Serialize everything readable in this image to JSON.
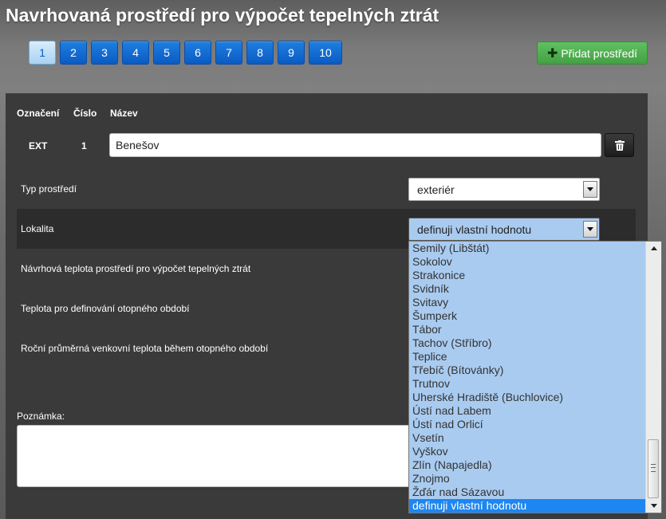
{
  "header": {
    "title": "Navrhovaná prostředí pro výpočet tepelných ztrát"
  },
  "pagination": {
    "pages": [
      "1",
      "2",
      "3",
      "4",
      "5",
      "6",
      "7",
      "8",
      "9",
      "10"
    ],
    "active_index": 0
  },
  "toolbar": {
    "add_env_label": "Přidat prostředí",
    "add_env_icon": "plus-icon"
  },
  "table": {
    "headers": {
      "designation": "Označení",
      "number": "Číslo",
      "name": "Název"
    },
    "row": {
      "designation": "EXT",
      "number": "1",
      "name": "Benešov"
    },
    "delete_icon": "trash-icon"
  },
  "form": {
    "env_type": {
      "label": "Typ prostředí",
      "value": "exteriér"
    },
    "locality": {
      "label": "Lokalita",
      "value": "definuji vlastní hodnotu"
    },
    "design_temp": {
      "label": "Návrhová teplota prostředí pro výpočet tepelných ztrát"
    },
    "heating_temp": {
      "label": "Teplota pro definování otopného období"
    },
    "avg_temp": {
      "label": "Roční průměrná venkovní teplota během otopného období"
    },
    "note": {
      "label": "Poznámka:",
      "value": ""
    }
  },
  "dropdown": {
    "options": [
      "Semily (Libštát)",
      "Sokolov",
      "Strakonice",
      "Svidník",
      "Svitavy",
      "Šumperk",
      "Tábor",
      "Tachov (Stříbro)",
      "Teplice",
      "Třebíč (Bítovánky)",
      "Trutnov",
      "Uherské Hradiště (Buchlovice)",
      "Ústí nad Labem",
      "Ústí nad Orlicí",
      "Vsetín",
      "Vyškov",
      "Zlín (Napajedla)",
      "Znojmo",
      "Žďár nad Sázavou",
      "definuji vlastní hodnotu"
    ],
    "selected_index": 19
  },
  "colors": {
    "primary_blue": "#0a5bc4",
    "success_green": "#43a043",
    "dropdown_bg": "#a9cbf0",
    "dropdown_selected": "#1e86f0",
    "panel_bg": "#3a3a3a"
  }
}
